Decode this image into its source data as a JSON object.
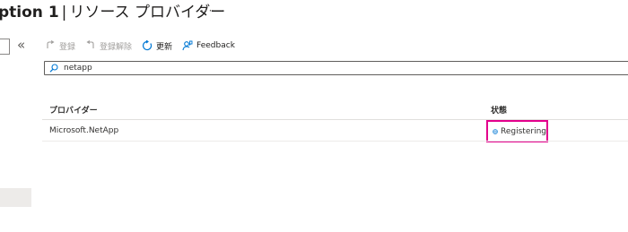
{
  "header": {
    "title_prefix": "ption 1",
    "separator": "|",
    "title_rest": "リソース プロバイダー",
    "more_label": "···"
  },
  "sidebar": {
    "collapse_label": "«"
  },
  "toolbar": {
    "register_label": "登録",
    "unregister_label": "登録解除",
    "refresh_label": "更新",
    "feedback_label": "Feedback"
  },
  "search": {
    "value": "netapp"
  },
  "table": {
    "columns": [
      "プロバイダー",
      "状態"
    ],
    "rows": [
      {
        "provider": "Microsoft.NetApp",
        "status": "Registering"
      }
    ]
  },
  "colors": {
    "highlight": "#e3008c",
    "accent": "#0078d4"
  },
  "icons": {
    "register": "register-icon",
    "unregister": "unregister-icon",
    "refresh": "refresh-icon",
    "feedback": "feedback-icon",
    "search": "search-icon",
    "status": "globe-icon"
  }
}
